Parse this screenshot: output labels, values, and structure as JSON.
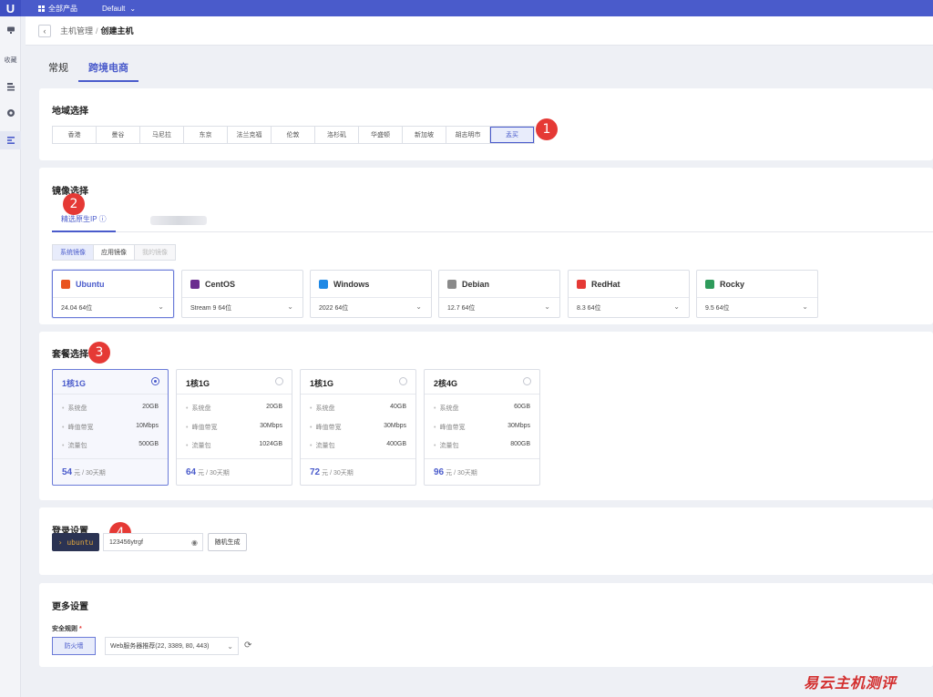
{
  "topbar": {
    "logo": "U",
    "all_products": "全部产品",
    "project": "Default"
  },
  "sidebar": {
    "favorites_label": "收藏"
  },
  "breadcrumb": {
    "back_icon": "chevron-left-icon",
    "parent": "主机管理",
    "sep": "/",
    "current": "创建主机"
  },
  "tabs": [
    {
      "label": "常规"
    },
    {
      "label": "跨境电商",
      "active": true
    }
  ],
  "region": {
    "title": "地域选择",
    "options": [
      "香港",
      "曼谷",
      "马尼拉",
      "东京",
      "法兰克福",
      "伦敦",
      "洛杉矶",
      "华盛顿",
      "新加坡",
      "胡志明市",
      "孟买"
    ],
    "selected": "孟买"
  },
  "image": {
    "title": "镜像选择",
    "subtab": "精选原生IP",
    "types": [
      {
        "label": "系统镜像",
        "selected": true
      },
      {
        "label": "应用镜像"
      },
      {
        "label": "我的镜像",
        "disabled": true
      }
    ],
    "os": [
      {
        "name": "Ubuntu",
        "version": "24.04 64位",
        "selected": true,
        "color": "#e95420"
      },
      {
        "name": "CentOS",
        "version": "Stream 9 64位",
        "color": "#6a2c8f"
      },
      {
        "name": "Windows",
        "version": "2022 64位",
        "color": "#1e88e5"
      },
      {
        "name": "Debian",
        "version": "12.7 64位",
        "color": "#8a8a8a"
      },
      {
        "name": "RedHat",
        "version": "8.3 64位",
        "color": "#e53935"
      },
      {
        "name": "Rocky",
        "version": "9.5 64位",
        "color": "#2e9b5b"
      }
    ]
  },
  "plan": {
    "title": "套餐选择",
    "spec_labels": {
      "disk": "系统盘",
      "bandwidth": "峰值带宽",
      "traffic": "流量包"
    },
    "price_unit": "元 / 30天期",
    "cards": [
      {
        "name": "1核1G",
        "disk": "20GB",
        "bandwidth": "10Mbps",
        "traffic": "500GB",
        "price": "54",
        "selected": true
      },
      {
        "name": "1核1G",
        "disk": "20GB",
        "bandwidth": "30Mbps",
        "traffic": "1024GB",
        "price": "64"
      },
      {
        "name": "1核1G",
        "disk": "40GB",
        "bandwidth": "30Mbps",
        "traffic": "400GB",
        "price": "72"
      },
      {
        "name": "2核4G",
        "disk": "60GB",
        "bandwidth": "30Mbps",
        "traffic": "800GB",
        "price": "96"
      }
    ]
  },
  "login": {
    "title": "登录设置",
    "user": "› ubuntu",
    "password": "123456ytrgf",
    "generate": "随机生成"
  },
  "more": {
    "title": "更多设置",
    "security_label": "安全规则",
    "required_mark": "*",
    "firewall": "防火墙",
    "rule": "Web服务器推荐(22, 3389, 80, 443)"
  },
  "badges": [
    "1",
    "2",
    "3",
    "4"
  ],
  "watermark": "易云主机测评",
  "colors": {
    "primary": "#4a5bcb",
    "badge": "#e53935",
    "user_chip_bg": "#2b3353"
  }
}
